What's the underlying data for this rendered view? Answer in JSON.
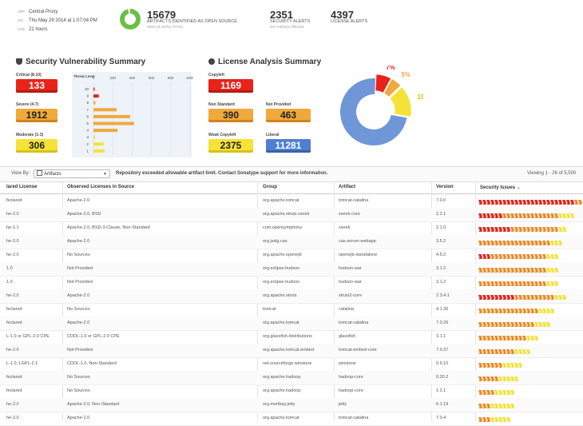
{
  "header": {
    "meta": [
      {
        "label": "App",
        "value": "Central Proxy"
      },
      {
        "label": "On",
        "value": "Thu May 29 2014 at 1:07:04 PM"
      },
      {
        "label": "Age",
        "value": "21 hours"
      }
    ],
    "open_source_fraction": 0.96,
    "stats": [
      {
        "number": "15679",
        "label": "Artifacts Identified as Open Source",
        "sub": "100% of 15751 TOTAL"
      },
      {
        "number": "2351",
        "label": "Security Alerts",
        "sub": "547 Artifacts Affected"
      },
      {
        "number": "4397",
        "label": "License Alerts",
        "sub": ""
      }
    ]
  },
  "security": {
    "title": "Security Vulnerability Summary",
    "badges": [
      {
        "label": "Critical (8-10)",
        "value": "133",
        "color": "#e8231a"
      },
      {
        "label": "Severe (4-7)",
        "value": "1912",
        "color": "#f0a93b"
      },
      {
        "label": "Moderate (1-3)",
        "value": "306",
        "color": "#f5e237"
      }
    ]
  },
  "chart_data": {
    "type": "bar",
    "orientation": "horizontal",
    "ylabel": "Threat Level",
    "categories": [
      "10",
      "9",
      "8",
      "7",
      "6",
      "5",
      "4",
      "3",
      "2",
      "1"
    ],
    "values": [
      2,
      55,
      20,
      240,
      380,
      420,
      250,
      18,
      105,
      115
    ],
    "colors": [
      "#e8231a",
      "#e8231a",
      "#f0a93b",
      "#f0a93b",
      "#f0a93b",
      "#f0a93b",
      "#f0a93b",
      "#f5e237",
      "#f5e237",
      "#f5e237"
    ],
    "xlim": [
      0,
      1000
    ],
    "xticks": [
      "0",
      "200",
      "400",
      "600",
      "800",
      "1000"
    ]
  },
  "license": {
    "title": "License Analysis Summary",
    "badges": [
      {
        "label": "Copyleft",
        "value": "1169",
        "color": "#e8231a"
      },
      {
        "label": "Non Standard",
        "value": "390",
        "color": "#f0a93b"
      },
      {
        "label": "Not Provided",
        "value": "463",
        "color": "#f0a93b"
      },
      {
        "label": "Weak Copyleft",
        "value": "2375",
        "color": "#f5e237"
      },
      {
        "label": "Liberal",
        "value": "11281",
        "color": "#4f7fcf"
      }
    ],
    "pie": {
      "type": "pie",
      "slices": [
        {
          "label": "7%",
          "value": 7,
          "color": "#e8231a"
        },
        {
          "label": "5%",
          "value": 5,
          "color": "#f0a93b"
        },
        {
          "label": "15%",
          "value": 15,
          "color": "#f5e237"
        },
        {
          "label": "",
          "value": 73,
          "color": "#6f96d6"
        }
      ]
    }
  },
  "toolbar": {
    "view_by_label": "View By:",
    "view_by_value": "Artifacts",
    "notice": "Repository exceeded allowable artifact limit. Contact Sonatype support for more information.",
    "viewing": "Viewing 1 - 26 of 5,500"
  },
  "table": {
    "columns": [
      "lared License",
      "Observed Licenses in Source",
      "Group",
      "Artifact",
      "Version",
      "Security Issues"
    ],
    "rows": [
      {
        "license": "feclared",
        "observed": "Apache-2.0",
        "group": "org.apache.tomcat",
        "artifact": "tomcat-catalina",
        "version": "7.0.0",
        "issues": [
          24,
          10,
          3
        ]
      },
      {
        "license": "he-2.0",
        "observed": "Apache-2.0, BSD",
        "group": "org.apache.struts.xwork",
        "artifact": "xwork-core",
        "version": "2.2.1",
        "issues": [
          6,
          14,
          4
        ]
      },
      {
        "license": "he-1.1",
        "observed": "Apache-2.0, BSD-3-Clause, Non-Standard",
        "group": "com.opensymphony",
        "artifact": "xwork",
        "version": "2.1.0",
        "issues": [
          8,
          12,
          2
        ]
      },
      {
        "license": "he-2.0",
        "observed": "Apache-2.0",
        "group": "org.jsslg.cas",
        "artifact": "cas-server-webapp",
        "version": "3.5.2",
        "issues": [
          0,
          18,
          3
        ]
      },
      {
        "license": "he-2.0",
        "observed": "No Sources",
        "group": "org.apache.openejb",
        "artifact": "openejb-standalone",
        "version": "4.5.2",
        "issues": [
          3,
          14,
          3
        ]
      },
      {
        "license": "1.0",
        "observed": "Not Provided",
        "group": "org.eclipse.hudson",
        "artifact": "hudson-war",
        "version": "3.1.2",
        "issues": [
          0,
          17,
          3
        ]
      },
      {
        "license": "1.0",
        "observed": "Not Provided",
        "group": "org.eclipse.hudson",
        "artifact": "hudson-war",
        "version": "3.1.2",
        "issues": [
          0,
          17,
          3
        ]
      },
      {
        "license": "he-2.0",
        "observed": "Apache-2.0",
        "group": "org.apache.struts",
        "artifact": "struts2-core",
        "version": "2.3.4.1",
        "issues": [
          9,
          10,
          3
        ]
      },
      {
        "license": "feclared",
        "observed": "No Sources",
        "group": "tomcat",
        "artifact": "catalina",
        "version": "4.1.36",
        "issues": [
          0,
          15,
          4
        ]
      },
      {
        "license": "feclared",
        "observed": "Apache-2.0",
        "group": "org.apache.tomcat",
        "artifact": "tomcat-catalina",
        "version": "7.0.26",
        "issues": [
          0,
          14,
          4
        ]
      },
      {
        "license": "L-1.0 or GPL-2.0 CPE",
        "observed": "CDDL-1.0 or GPL-2.0 CPE",
        "group": "org.glassfish.distributions",
        "artifact": "glassfish",
        "version": "3.1.1",
        "issues": [
          0,
          12,
          3
        ]
      },
      {
        "license": "he-2.0",
        "observed": "Not Provided",
        "group": "org.apache.tomcat.embed",
        "artifact": "tomcat-embed-core",
        "version": "7.0.37",
        "issues": [
          0,
          9,
          4
        ]
      },
      {
        "license": "L-1.0, LGPL-2.1",
        "observed": "CDDL-1.0, Non-Standard",
        "group": "net.sourceforge.winstone",
        "artifact": "winstone",
        "version": "0.9.10",
        "issues": [
          0,
          6,
          5
        ]
      },
      {
        "license": "feclared",
        "observed": "No Sources",
        "group": "org.apache.hadoop",
        "artifact": "hadoop-core",
        "version": "0.20.2",
        "issues": [
          0,
          5,
          5
        ]
      },
      {
        "license": "feclared",
        "observed": "No Sources",
        "group": "org.apache.hadoop",
        "artifact": "hadoop-core",
        "version": "1.2.1",
        "issues": [
          0,
          4,
          5
        ]
      },
      {
        "license": "he-2.0",
        "observed": "Apache-2.0, Non-Standard",
        "group": "org.mortbay.jetty",
        "artifact": "jetty",
        "version": "6.1.19",
        "issues": [
          0,
          3,
          6
        ]
      },
      {
        "license": "he-2.0",
        "observed": "Apache-2.0",
        "group": "org.apache.tomcat",
        "artifact": "tomcat-catalina",
        "version": "7.0.4",
        "issues": [
          0,
          3,
          5
        ]
      }
    ]
  },
  "colors": {
    "critical": "#e8231a",
    "severe": "#f0a93b",
    "moderate": "#f5e237",
    "liberal": "#4f7fcf",
    "accent": "#6cbe45"
  }
}
